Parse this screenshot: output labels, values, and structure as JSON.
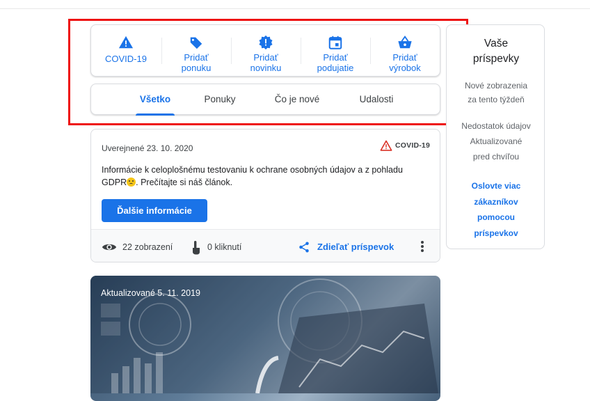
{
  "actions": [
    {
      "label": "COVID-19"
    },
    {
      "label": "Pridať ponuku"
    },
    {
      "label": "Pridať novinku"
    },
    {
      "label": "Pridať podujatie"
    },
    {
      "label": "Pridať výrobok"
    }
  ],
  "actions_split": {
    "a1": [
      "Pridať",
      "ponuku"
    ],
    "a2": [
      "Pridať",
      "novinku"
    ],
    "a3": [
      "Pridať",
      "podujatie"
    ],
    "a4": [
      "Pridať",
      "výrobok"
    ]
  },
  "tabs": [
    {
      "label": "Všetko",
      "active": true
    },
    {
      "label": "Ponuky"
    },
    {
      "label": "Čo je nové"
    },
    {
      "label": "Udalosti"
    }
  ],
  "post": {
    "date": "Uverejnené 23. 10. 2020",
    "badge": "COVID-19",
    "text_before": "Informácie k celoplošnému testovaniu k ochrane osobných údajov a z pohladu GDPR",
    "text_after": ". Prečítajte si náš článok.",
    "button": "Ďalšie informácie",
    "views": "22 zobrazení",
    "clicks": "0 kliknutí",
    "share": "Zdieľať príspevok"
  },
  "image_post": {
    "date": "Aktualizované 5. 11. 2019"
  },
  "side": {
    "title_1": "Vaše",
    "title_2": "príspevky",
    "line_1": "Nové zobrazenia",
    "line_2": "za tento týždeň",
    "line_3": "Nedostatok údajov",
    "line_4": "Aktualizované",
    "line_5": "pred chvíľou",
    "link_1": "Oslovte viac",
    "link_2": "zákazníkov",
    "link_3": "pomocou",
    "link_4": "príspevkov"
  },
  "colors": {
    "accent": "#1a73e8",
    "highlight": "#ee1111",
    "warning": "#d93025"
  }
}
